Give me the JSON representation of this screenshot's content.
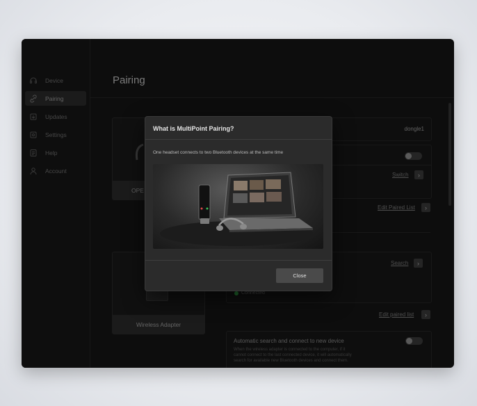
{
  "sidebar": {
    "items": [
      {
        "label": "Device",
        "icon": "headset-icon"
      },
      {
        "label": "Pairing",
        "icon": "link-icon"
      },
      {
        "label": "Updates",
        "icon": "update-icon"
      },
      {
        "label": "Settings",
        "icon": "gear-icon"
      },
      {
        "label": "Help",
        "icon": "help-icon"
      },
      {
        "label": "Account",
        "icon": "user-icon"
      }
    ],
    "active": "Pairing"
  },
  "page": {
    "title": "Pairing"
  },
  "headset_card": {
    "label": "OPE"
  },
  "adapter_card": {
    "label": "Wireless Adapter"
  },
  "right_panel": {
    "dongle_name": "dongle1",
    "switch_label": "Switch",
    "edit_paired_list_label": "Edit Paired List",
    "search_label": "Search",
    "connected_status": "Connected",
    "edit_paired_list_lower_label": "Edit paired list",
    "auto_search_title": "Automatic search and connect to new device",
    "auto_search_desc_1": "When the wireless adapter is connected to the computer, if it",
    "auto_search_desc_2": "cannot connect to the last connected device, it will automatically",
    "auto_search_desc_3": "search for available new Bluetooth devices and connect them."
  },
  "modal": {
    "title": "What is MultiPoint Pairing?",
    "description": "One headset connects to two Bluetooth devices at the same time",
    "close_label": "Close"
  },
  "colors": {
    "window_bg": "#141414",
    "modal_bg": "#2b2b2b",
    "status_green": "#2ea043"
  }
}
